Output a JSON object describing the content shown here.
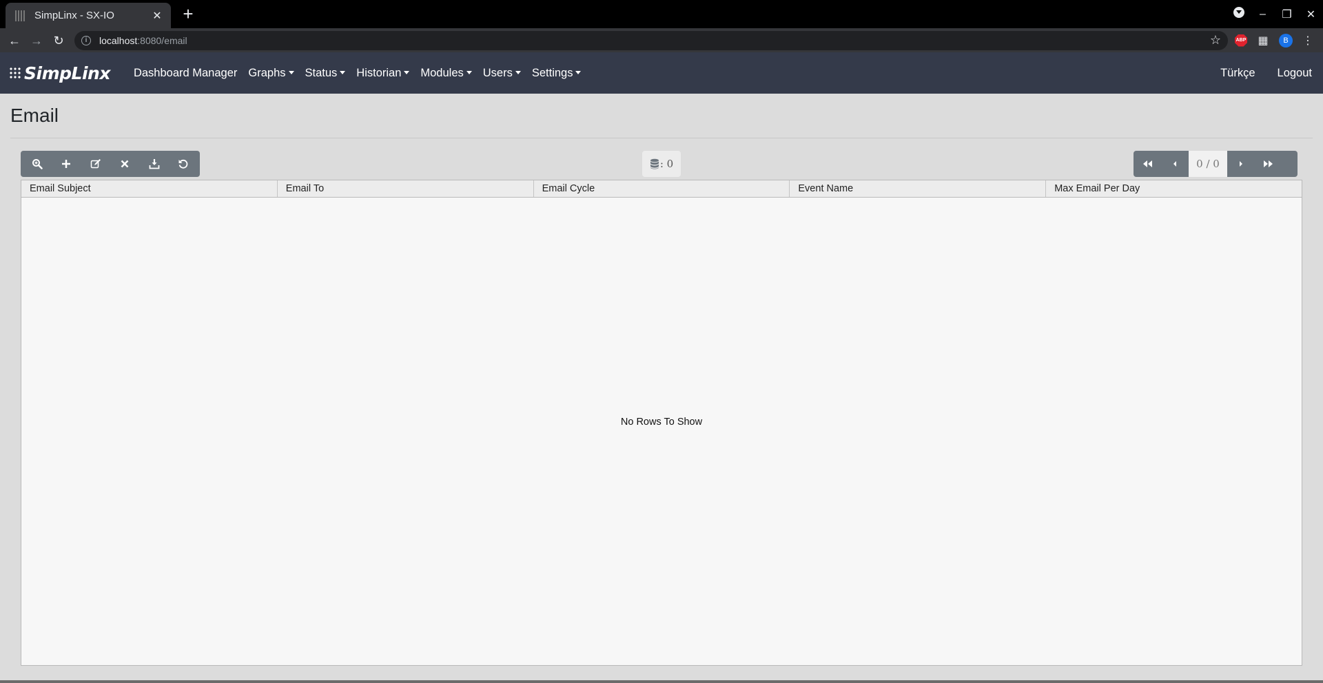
{
  "browser": {
    "tab_title": "SimpLinx - SX-IO",
    "tab_close": "✕",
    "new_tab": "+",
    "url_host": "localhost",
    "url_path": ":8080/email",
    "profile_initial": "B",
    "abp_label": "ABP"
  },
  "navbar": {
    "brand": "SimpLinx",
    "items": [
      {
        "label": "Dashboard Manager",
        "dropdown": false
      },
      {
        "label": "Graphs",
        "dropdown": true
      },
      {
        "label": "Status",
        "dropdown": true
      },
      {
        "label": "Historian",
        "dropdown": true
      },
      {
        "label": "Modules",
        "dropdown": true
      },
      {
        "label": "Users",
        "dropdown": true
      },
      {
        "label": "Settings",
        "dropdown": true
      }
    ],
    "language": "Türkçe",
    "logout": "Logout"
  },
  "page": {
    "title": "Email"
  },
  "toolbar": {
    "record_count": ": 0"
  },
  "pager": {
    "info": "0 / 0"
  },
  "grid": {
    "columns": [
      "Email Subject",
      "Email To",
      "Email Cycle",
      "Event Name",
      "Max Email Per Day"
    ],
    "empty_message": "No Rows To Show"
  },
  "colors": {
    "navbar_bg": "#343a4a",
    "button_group_bg": "#6c757d",
    "page_bg": "#dcdcdc"
  }
}
